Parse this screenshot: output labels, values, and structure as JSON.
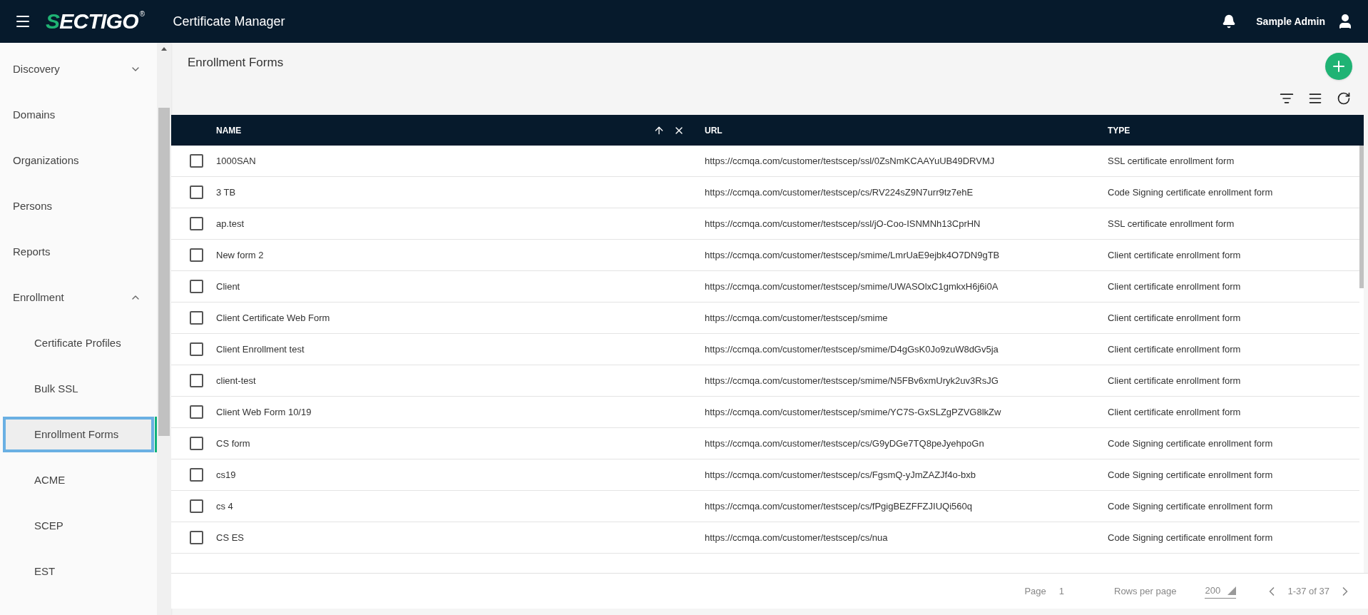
{
  "header": {
    "logo": "SECTIGO",
    "logo_mark": "®",
    "title": "Certificate Manager",
    "user": "Sample Admin"
  },
  "sidebar": {
    "items": [
      {
        "label": "Discovery",
        "expandable": true,
        "expanded": false,
        "selected": false
      },
      {
        "label": "Domains",
        "expandable": false,
        "selected": false
      },
      {
        "label": "Organizations",
        "expandable": false,
        "selected": false
      },
      {
        "label": "Persons",
        "expandable": false,
        "selected": false
      },
      {
        "label": "Reports",
        "expandable": false,
        "selected": false
      },
      {
        "label": "Enrollment",
        "expandable": true,
        "expanded": true,
        "selected": false,
        "children": [
          {
            "label": "Certificate Profiles",
            "selected": false
          },
          {
            "label": "Bulk SSL",
            "selected": false
          },
          {
            "label": "Enrollment Forms",
            "selected": true
          },
          {
            "label": "ACME",
            "selected": false
          },
          {
            "label": "SCEP",
            "selected": false
          },
          {
            "label": "EST",
            "selected": false
          }
        ]
      }
    ]
  },
  "page": {
    "title": "Enrollment Forms"
  },
  "table": {
    "columns": [
      {
        "label": "NAME",
        "sorted": true
      },
      {
        "label": "URL",
        "sorted": false
      },
      {
        "label": "TYPE",
        "sorted": false
      }
    ],
    "rows": [
      {
        "checked": false,
        "name": "1000SAN",
        "url": "https://ccmqa.com/customer/testscep/ssl/0ZsNmKCAAYuUB49DRVMJ",
        "type": "SSL certificate enrollment form"
      },
      {
        "checked": false,
        "name": "3 TB",
        "url": "https://ccmqa.com/customer/testscep/cs/RV224sZ9N7urr9tz7ehE",
        "type": "Code Signing certificate enrollment form"
      },
      {
        "checked": false,
        "name": "ap.test",
        "url": "https://ccmqa.com/customer/testscep/ssl/jO-Coo-ISNMNh13CprHN",
        "type": "SSL certificate enrollment form"
      },
      {
        "checked": false,
        "name": "New form 2",
        "url": "https://ccmqa.com/customer/testscep/smime/LmrUaE9ejbk4O7DN9gTB",
        "type": "Client certificate enrollment form"
      },
      {
        "checked": false,
        "name": "Client",
        "url": "https://ccmqa.com/customer/testscep/smime/UWASOlxC1gmkxH6j6i0A",
        "type": "Client certificate enrollment form"
      },
      {
        "checked": false,
        "name": "Client Certificate Web Form",
        "url": "https://ccmqa.com/customer/testscep/smime",
        "type": "Client certificate enrollment form"
      },
      {
        "checked": false,
        "name": "Client Enrollment test",
        "url": "https://ccmqa.com/customer/testscep/smime/D4gGsK0Jo9zuW8dGv5ja",
        "type": "Client certificate enrollment form"
      },
      {
        "checked": false,
        "name": "client-test",
        "url": "https://ccmqa.com/customer/testscep/smime/N5FBv6xmUryk2uv3RsJG",
        "type": "Client certificate enrollment form"
      },
      {
        "checked": false,
        "name": "Client Web Form 10/19",
        "url": "https://ccmqa.com/customer/testscep/smime/YC7S-GxSLZgPZVG8lkZw",
        "type": "Client certificate enrollment form"
      },
      {
        "checked": false,
        "name": "CS form",
        "url": "https://ccmqa.com/customer/testscep/cs/G9yDGe7TQ8peJyehpoGn",
        "type": "Code Signing certificate enrollment form"
      },
      {
        "checked": false,
        "name": "cs19",
        "url": "https://ccmqa.com/customer/testscep/cs/FgsmQ-yJmZAZJf4o-bxb",
        "type": "Code Signing certificate enrollment form"
      },
      {
        "checked": false,
        "name": "cs 4",
        "url": "https://ccmqa.com/customer/testscep/cs/fPgigBEZFFZJIUQi560q",
        "type": "Code Signing certificate enrollment form"
      },
      {
        "checked": false,
        "name": "CS ES",
        "url": "https://ccmqa.com/customer/testscep/cs/nua",
        "type": "Code Signing certificate enrollment form"
      }
    ]
  },
  "pagination": {
    "page_label": "Page",
    "page": "1",
    "rows_label": "Rows per page",
    "rows_per_page": "200",
    "range": "1-37 of 37"
  }
}
